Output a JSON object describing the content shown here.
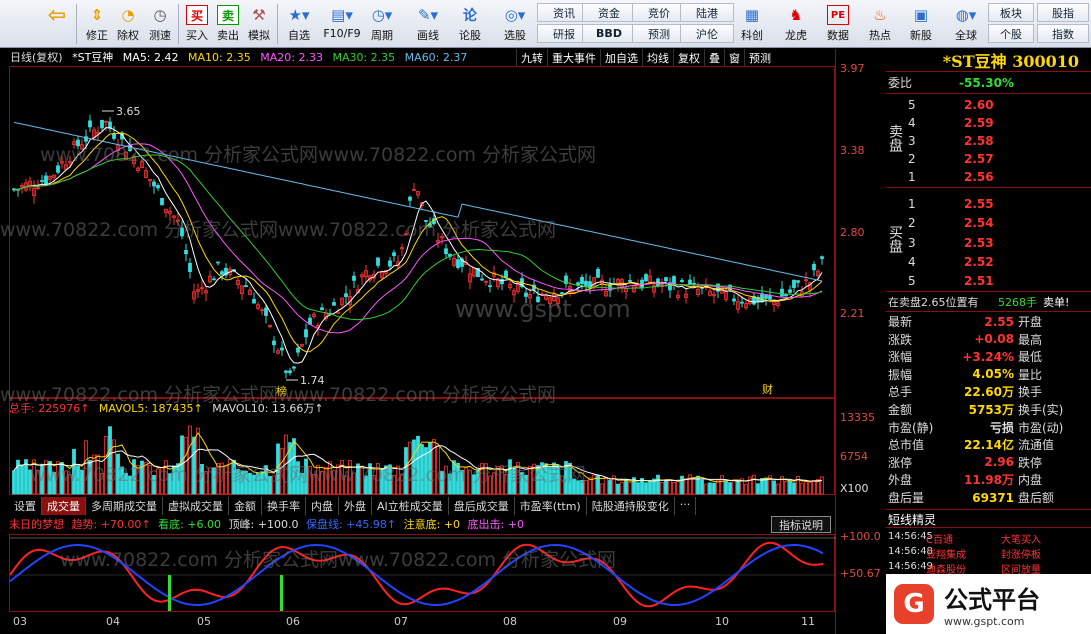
{
  "toolbar": {
    "buttons": [
      {
        "label": "",
        "icon": "back-arrow-icon"
      },
      {
        "label": "修正",
        "icon": "up-down-arrow-icon"
      },
      {
        "label": "除权",
        "icon": "dividend-icon"
      },
      {
        "label": "测速",
        "icon": "speed-icon"
      },
      {
        "label": "买入",
        "icon": "buy-icon"
      },
      {
        "label": "卖出",
        "icon": "sell-icon"
      },
      {
        "label": "模拟",
        "icon": "hammer-icon"
      },
      {
        "label": "自选",
        "icon": "favorites-icon"
      },
      {
        "label": "F10/F9",
        "icon": "f10-icon"
      },
      {
        "label": "周期",
        "icon": "clock-icon"
      },
      {
        "label": "画线",
        "icon": "pencil-icon"
      },
      {
        "label": "论股",
        "icon": "discuss-icon"
      },
      {
        "label": "选股",
        "icon": "select-icon"
      },
      {
        "label": "科创",
        "icon": "star-board-icon"
      },
      {
        "label": "龙虎",
        "icon": "dragon-icon"
      },
      {
        "label": "数据",
        "icon": "pe-data-icon"
      },
      {
        "label": "热点",
        "icon": "hot-icon"
      },
      {
        "label": "新股",
        "icon": "new-stock-icon"
      },
      {
        "label": "全球",
        "icon": "globe-icon"
      }
    ],
    "nav": [
      "资讯",
      "研报",
      "资金",
      "BBD",
      "竞价",
      "预测",
      "陆港",
      "沪伦",
      "板块",
      "个股",
      "股指",
      "指数"
    ],
    "buy_glyph": "买",
    "sell_glyph": "卖"
  },
  "chart": {
    "period": "日线(复权)",
    "stock": "*ST豆神",
    "ma": [
      {
        "label": "MA5: 2.42",
        "color": "#ffffff"
      },
      {
        "label": "MA10: 2.35",
        "color": "#ffd800"
      },
      {
        "label": "MA20: 2.33",
        "color": "#ff55ff"
      },
      {
        "label": "MA30: 2.35",
        "color": "#33cc33"
      },
      {
        "label": "MA60: 2.37",
        "color": "#66bbee"
      }
    ],
    "commands": [
      "九转",
      "重大事件",
      "加自选",
      "均线",
      "复权",
      "叠",
      "窗",
      "预测"
    ],
    "y_labels": [
      "3.97",
      "3.38",
      "2.80",
      "2.21"
    ],
    "high_label": "3.65",
    "low_label": "1.74",
    "mark_bang": "榜",
    "mark_cai": "财"
  },
  "volume": {
    "total_label": "总手: 225976↑",
    "mavol5_label": "MAVOL5: 187435↑",
    "mavol10_label": "MAVOL10: 13.66万↑",
    "y_labels": [
      "13335",
      "6754",
      "X100"
    ]
  },
  "tabs": [
    "设置",
    "成交量",
    "多周期成交量",
    "虚拟成交量",
    "金额",
    "换手率",
    "内盘",
    "外盘",
    "AI立桩成交量",
    "盘后成交量",
    "市盈率(ttm)",
    "陆股通持股变化",
    "···"
  ],
  "indicator": {
    "name": "末日的梦想",
    "trend": "趋势: +70.00↑",
    "bottom": "看底: +6.00",
    "top": "顶峰: +100.0",
    "guard": "保盘线: +45.98↑",
    "attention": "注意底: +0",
    "exit": "底出击: +0",
    "button": "指标说明",
    "y_labels": [
      "+100.0",
      "+50.67"
    ]
  },
  "xaxis": [
    "03",
    "04",
    "05",
    "06",
    "07",
    "08",
    "09",
    "10",
    "11"
  ],
  "quote": {
    "title": "*ST豆神 300010",
    "weibi_label": "委比",
    "weibi_value": "-55.30%",
    "sell_side": "卖盘",
    "buy_side": "买盘",
    "sells": [
      {
        "lvl": "5",
        "price": "2.60"
      },
      {
        "lvl": "4",
        "price": "2.59"
      },
      {
        "lvl": "3",
        "price": "2.58"
      },
      {
        "lvl": "2",
        "price": "2.57"
      },
      {
        "lvl": "1",
        "price": "2.56"
      }
    ],
    "buys": [
      {
        "lvl": "1",
        "price": "2.55"
      },
      {
        "lvl": "2",
        "price": "2.54"
      },
      {
        "lvl": "3",
        "price": "2.53"
      },
      {
        "lvl": "4",
        "price": "2.52"
      },
      {
        "lvl": "5",
        "price": "2.51"
      }
    ],
    "notice_left": "在卖盘2.65位置有",
    "notice_vol": "5268手",
    "notice_right": "卖单!",
    "stats": [
      {
        "l": "最新",
        "v": "2.55",
        "c": "#ff3333",
        "l2": "开盘",
        "v2": ""
      },
      {
        "l": "涨跌",
        "v": "+0.08",
        "c": "#ff3333",
        "l2": "最高",
        "v2": ""
      },
      {
        "l": "涨幅",
        "v": "+3.24%",
        "c": "#ff3333",
        "l2": "最低",
        "v2": ""
      },
      {
        "l": "振幅",
        "v": "4.05%",
        "c": "#ffd800",
        "l2": "量比",
        "v2": ""
      },
      {
        "l": "总手",
        "v": "22.60万",
        "c": "#ffd800",
        "l2": "换手",
        "v2": ""
      },
      {
        "l": "金额",
        "v": "5753万",
        "c": "#ffd800",
        "l2": "换手(实)",
        "v2": ""
      },
      {
        "l": "市盈(静)",
        "v": "亏损",
        "c": "#dddddd",
        "l2": "市盈(动)",
        "v2": ""
      },
      {
        "l": "总市值",
        "v": "22.14亿",
        "c": "#ffd800",
        "l2": "流通值",
        "v2": ""
      },
      {
        "l": "涨停",
        "v": "2.96",
        "c": "#ff3333",
        "l2": "跌停",
        "v2": ""
      },
      {
        "l": "外盘",
        "v": "11.98万",
        "c": "#ff3333",
        "l2": "内盘",
        "v2": ""
      },
      {
        "l": "盘后量",
        "v": "69371",
        "c": "#ffd800",
        "l2": "盘后额",
        "v2": ""
      }
    ],
    "sprite_title": "短线精灵",
    "trades": [
      {
        "t": "14:56:45",
        "n": "C百通",
        "d": "大笔买入"
      },
      {
        "t": "14:56:48",
        "n": "亚翔集成",
        "d": "封涨停板"
      },
      {
        "t": "14:56:49",
        "n": "迪森股份",
        "d": "区间放量"
      }
    ]
  },
  "logo": {
    "title": "公式平台",
    "url": "www.gspt.com",
    "mark": "G"
  },
  "watermarks": [
    "www.70822.com 分析家公式网www.70822.com 分析家公式网",
    "www.gspt.com"
  ]
}
